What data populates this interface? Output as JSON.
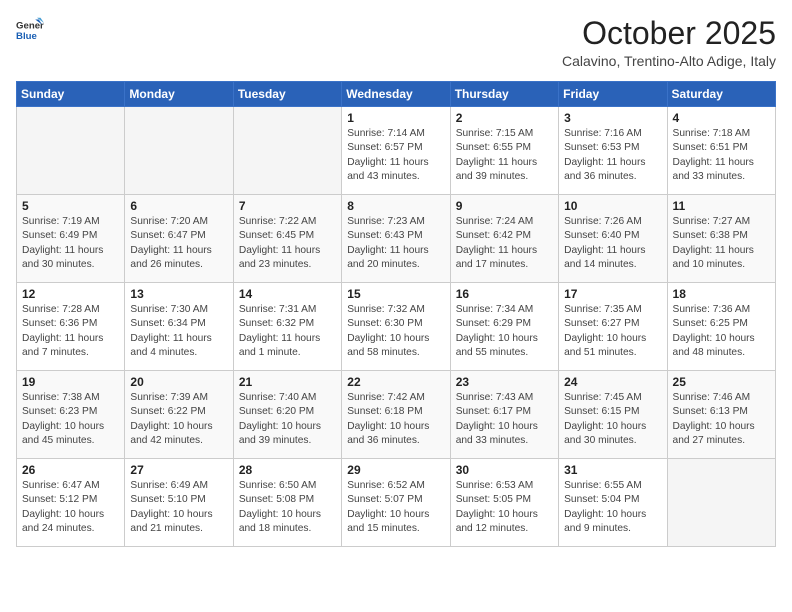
{
  "logo": {
    "line1": "General",
    "line2": "Blue"
  },
  "title": "October 2025",
  "subtitle": "Calavino, Trentino-Alto Adige, Italy",
  "days_of_week": [
    "Sunday",
    "Monday",
    "Tuesday",
    "Wednesday",
    "Thursday",
    "Friday",
    "Saturday"
  ],
  "weeks": [
    [
      {
        "day": "",
        "content": ""
      },
      {
        "day": "",
        "content": ""
      },
      {
        "day": "",
        "content": ""
      },
      {
        "day": "1",
        "content": "Sunrise: 7:14 AM\nSunset: 6:57 PM\nDaylight: 11 hours and 43 minutes."
      },
      {
        "day": "2",
        "content": "Sunrise: 7:15 AM\nSunset: 6:55 PM\nDaylight: 11 hours and 39 minutes."
      },
      {
        "day": "3",
        "content": "Sunrise: 7:16 AM\nSunset: 6:53 PM\nDaylight: 11 hours and 36 minutes."
      },
      {
        "day": "4",
        "content": "Sunrise: 7:18 AM\nSunset: 6:51 PM\nDaylight: 11 hours and 33 minutes."
      }
    ],
    [
      {
        "day": "5",
        "content": "Sunrise: 7:19 AM\nSunset: 6:49 PM\nDaylight: 11 hours and 30 minutes."
      },
      {
        "day": "6",
        "content": "Sunrise: 7:20 AM\nSunset: 6:47 PM\nDaylight: 11 hours and 26 minutes."
      },
      {
        "day": "7",
        "content": "Sunrise: 7:22 AM\nSunset: 6:45 PM\nDaylight: 11 hours and 23 minutes."
      },
      {
        "day": "8",
        "content": "Sunrise: 7:23 AM\nSunset: 6:43 PM\nDaylight: 11 hours and 20 minutes."
      },
      {
        "day": "9",
        "content": "Sunrise: 7:24 AM\nSunset: 6:42 PM\nDaylight: 11 hours and 17 minutes."
      },
      {
        "day": "10",
        "content": "Sunrise: 7:26 AM\nSunset: 6:40 PM\nDaylight: 11 hours and 14 minutes."
      },
      {
        "day": "11",
        "content": "Sunrise: 7:27 AM\nSunset: 6:38 PM\nDaylight: 11 hours and 10 minutes."
      }
    ],
    [
      {
        "day": "12",
        "content": "Sunrise: 7:28 AM\nSunset: 6:36 PM\nDaylight: 11 hours and 7 minutes."
      },
      {
        "day": "13",
        "content": "Sunrise: 7:30 AM\nSunset: 6:34 PM\nDaylight: 11 hours and 4 minutes."
      },
      {
        "day": "14",
        "content": "Sunrise: 7:31 AM\nSunset: 6:32 PM\nDaylight: 11 hours and 1 minute."
      },
      {
        "day": "15",
        "content": "Sunrise: 7:32 AM\nSunset: 6:30 PM\nDaylight: 10 hours and 58 minutes."
      },
      {
        "day": "16",
        "content": "Sunrise: 7:34 AM\nSunset: 6:29 PM\nDaylight: 10 hours and 55 minutes."
      },
      {
        "day": "17",
        "content": "Sunrise: 7:35 AM\nSunset: 6:27 PM\nDaylight: 10 hours and 51 minutes."
      },
      {
        "day": "18",
        "content": "Sunrise: 7:36 AM\nSunset: 6:25 PM\nDaylight: 10 hours and 48 minutes."
      }
    ],
    [
      {
        "day": "19",
        "content": "Sunrise: 7:38 AM\nSunset: 6:23 PM\nDaylight: 10 hours and 45 minutes."
      },
      {
        "day": "20",
        "content": "Sunrise: 7:39 AM\nSunset: 6:22 PM\nDaylight: 10 hours and 42 minutes."
      },
      {
        "day": "21",
        "content": "Sunrise: 7:40 AM\nSunset: 6:20 PM\nDaylight: 10 hours and 39 minutes."
      },
      {
        "day": "22",
        "content": "Sunrise: 7:42 AM\nSunset: 6:18 PM\nDaylight: 10 hours and 36 minutes."
      },
      {
        "day": "23",
        "content": "Sunrise: 7:43 AM\nSunset: 6:17 PM\nDaylight: 10 hours and 33 minutes."
      },
      {
        "day": "24",
        "content": "Sunrise: 7:45 AM\nSunset: 6:15 PM\nDaylight: 10 hours and 30 minutes."
      },
      {
        "day": "25",
        "content": "Sunrise: 7:46 AM\nSunset: 6:13 PM\nDaylight: 10 hours and 27 minutes."
      }
    ],
    [
      {
        "day": "26",
        "content": "Sunrise: 6:47 AM\nSunset: 5:12 PM\nDaylight: 10 hours and 24 minutes."
      },
      {
        "day": "27",
        "content": "Sunrise: 6:49 AM\nSunset: 5:10 PM\nDaylight: 10 hours and 21 minutes."
      },
      {
        "day": "28",
        "content": "Sunrise: 6:50 AM\nSunset: 5:08 PM\nDaylight: 10 hours and 18 minutes."
      },
      {
        "day": "29",
        "content": "Sunrise: 6:52 AM\nSunset: 5:07 PM\nDaylight: 10 hours and 15 minutes."
      },
      {
        "day": "30",
        "content": "Sunrise: 6:53 AM\nSunset: 5:05 PM\nDaylight: 10 hours and 12 minutes."
      },
      {
        "day": "31",
        "content": "Sunrise: 6:55 AM\nSunset: 5:04 PM\nDaylight: 10 hours and 9 minutes."
      },
      {
        "day": "",
        "content": ""
      }
    ]
  ]
}
